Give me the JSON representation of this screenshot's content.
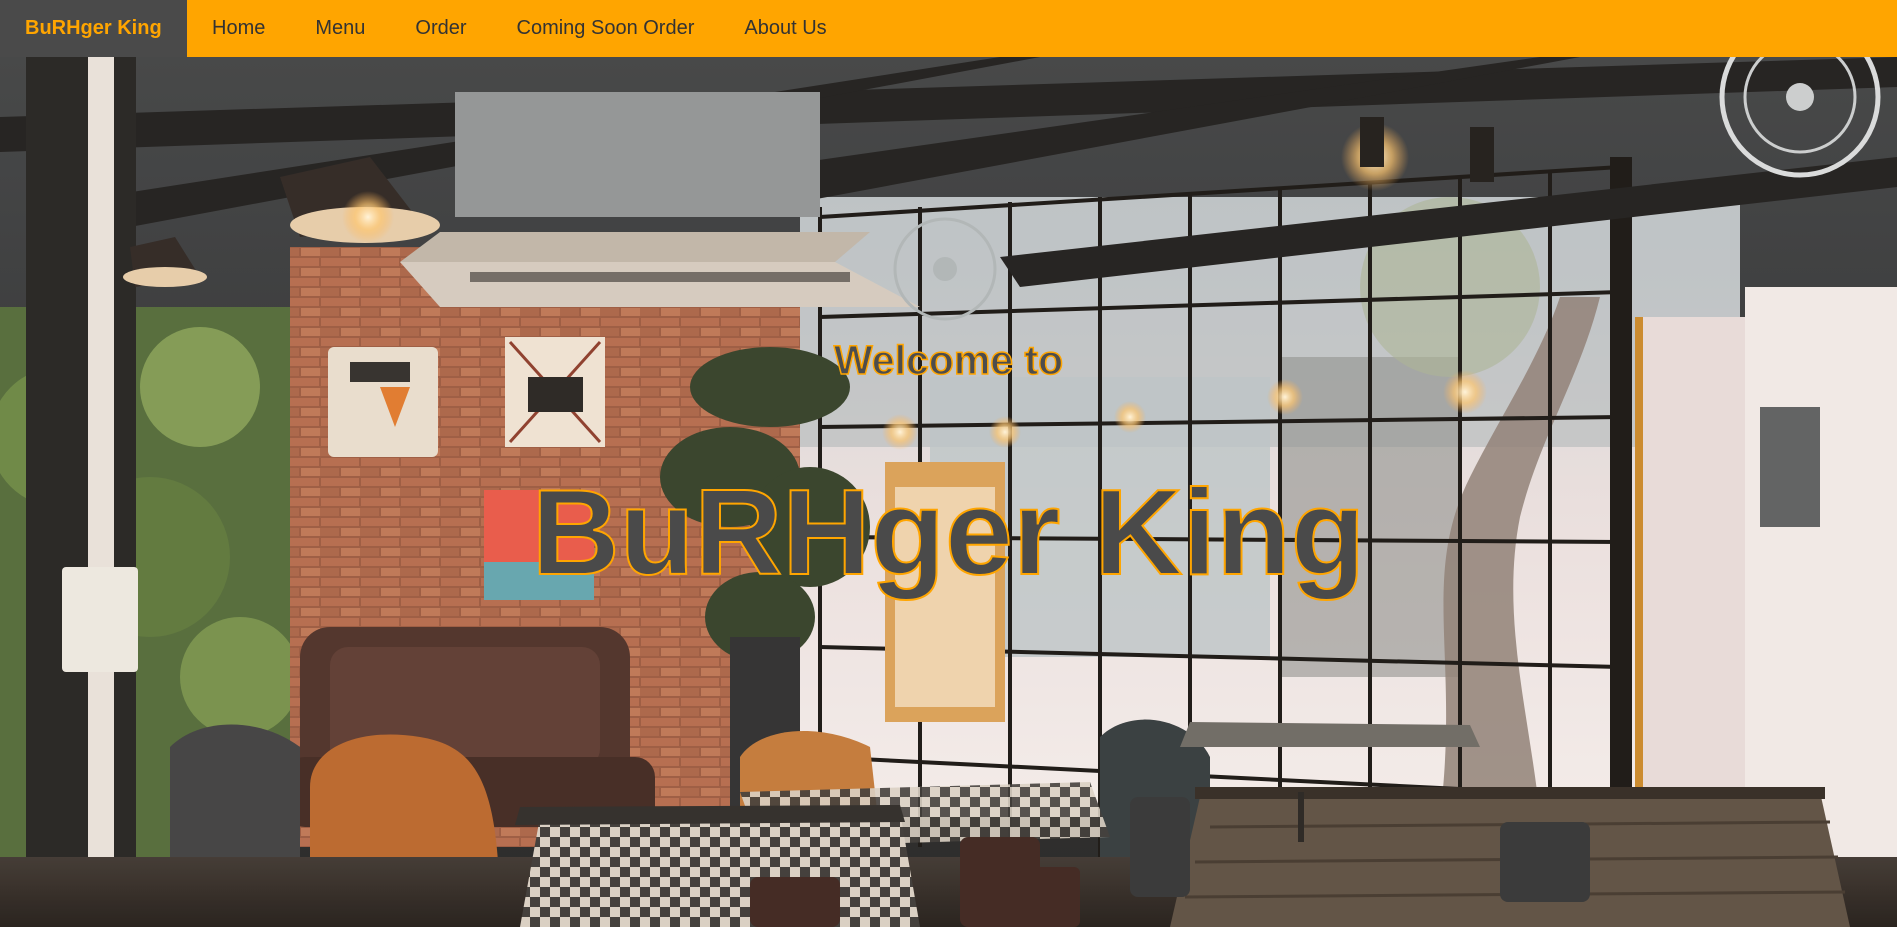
{
  "navbar": {
    "brand": "BuRHger King",
    "links": [
      "Home",
      "Menu",
      "Order",
      "Coming Soon Order",
      "About Us"
    ]
  },
  "hero": {
    "welcome": "Welcome to",
    "title": "BuRHger King",
    "background": "cafe-interior-photo"
  },
  "colors": {
    "accent": "#FFA500",
    "brand_bg": "#4a4a4a",
    "nav_text": "#333333",
    "title_fill": "#4a4a4a"
  }
}
